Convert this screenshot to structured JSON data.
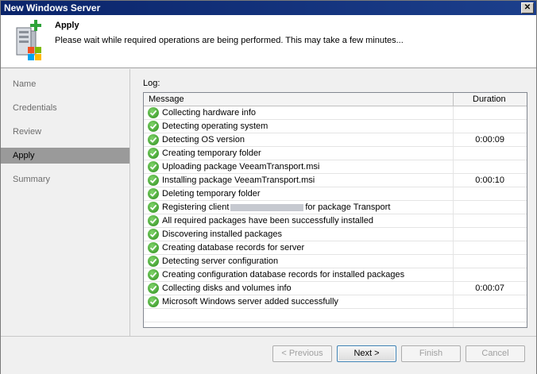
{
  "window": {
    "title": "New Windows Server"
  },
  "header": {
    "title": "Apply",
    "description": "Please wait while required operations are being performed. This may take a few minutes...",
    "icon": "server-add-icon"
  },
  "sidebar": {
    "items": [
      {
        "label": "Name",
        "active": false
      },
      {
        "label": "Credentials",
        "active": false
      },
      {
        "label": "Review",
        "active": false
      },
      {
        "label": "Apply",
        "active": true
      },
      {
        "label": "Summary",
        "active": false
      }
    ]
  },
  "log": {
    "label": "Log:",
    "columns": {
      "message": "Message",
      "duration": "Duration"
    },
    "rows": [
      {
        "message": "Collecting hardware info",
        "duration": ""
      },
      {
        "message": "Detecting operating system",
        "duration": ""
      },
      {
        "message": "Detecting OS version",
        "duration": "0:00:09"
      },
      {
        "message": "Creating temporary folder",
        "duration": ""
      },
      {
        "message": "Uploading package VeeamTransport.msi",
        "duration": ""
      },
      {
        "message": "Installing package VeeamTransport.msi",
        "duration": "0:00:10"
      },
      {
        "message": "Deleting temporary folder",
        "duration": ""
      },
      {
        "message_pre": "Registering client",
        "message_post": "for package Transport",
        "duration": ""
      },
      {
        "message": "All required packages have been successfully installed",
        "duration": ""
      },
      {
        "message": "Discovering installed packages",
        "duration": ""
      },
      {
        "message": "Creating database records for server",
        "duration": ""
      },
      {
        "message": "Detecting server configuration",
        "duration": ""
      },
      {
        "message": "Creating configuration database records for installed packages",
        "duration": ""
      },
      {
        "message": "Collecting disks and volumes info",
        "duration": "0:00:07"
      },
      {
        "message": "Microsoft Windows server added successfully",
        "duration": ""
      }
    ]
  },
  "footer": {
    "previous": "< Previous",
    "next": "Next >",
    "finish": "Finish",
    "cancel": "Cancel"
  },
  "colors": {
    "success": "#3ca12a",
    "active_step": "#9a9a9a",
    "titlebar": "#0a246a"
  }
}
